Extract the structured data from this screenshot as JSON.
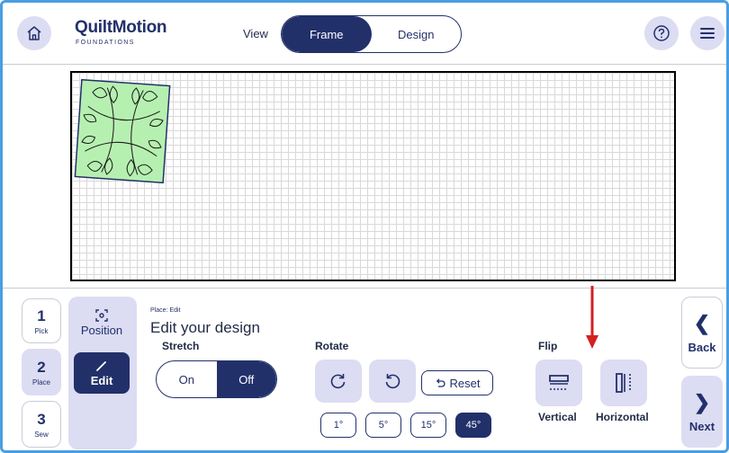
{
  "header": {
    "brand": "QuiltMotion",
    "brand_sub": "FOUNDATIONS",
    "brand_mark": "X",
    "view_label": "View",
    "view_options": [
      "Frame",
      "Design"
    ],
    "view_selected": "Frame"
  },
  "icons": {
    "home": "home-icon",
    "help": "help-icon",
    "menu": "hamburger-menu-icon"
  },
  "steps": [
    {
      "num": "1",
      "label": "Pick"
    },
    {
      "num": "2",
      "label": "Place"
    },
    {
      "num": "3",
      "label": "Sew"
    }
  ],
  "substeps": {
    "position": "Position",
    "edit": "Edit"
  },
  "edit_panel": {
    "breadcrumb": "Place: Edit",
    "heading": "Edit your design",
    "stretch": {
      "label": "Stretch",
      "on": "On",
      "off": "Off",
      "selected": "Off"
    },
    "rotate": {
      "label": "Rotate",
      "reset": "Reset",
      "increments": [
        "1°",
        "5°",
        "15°",
        "45°"
      ],
      "selected_increment": "45°"
    },
    "flip": {
      "label": "Flip",
      "vertical": "Vertical",
      "horizontal": "Horizontal"
    }
  },
  "nav": {
    "back": "Back",
    "next": "Next"
  },
  "colors": {
    "primary": "#22306a",
    "accent_light": "#dcdcf3",
    "design_fill": "#b6f0b0",
    "arrow": "#d32020"
  }
}
